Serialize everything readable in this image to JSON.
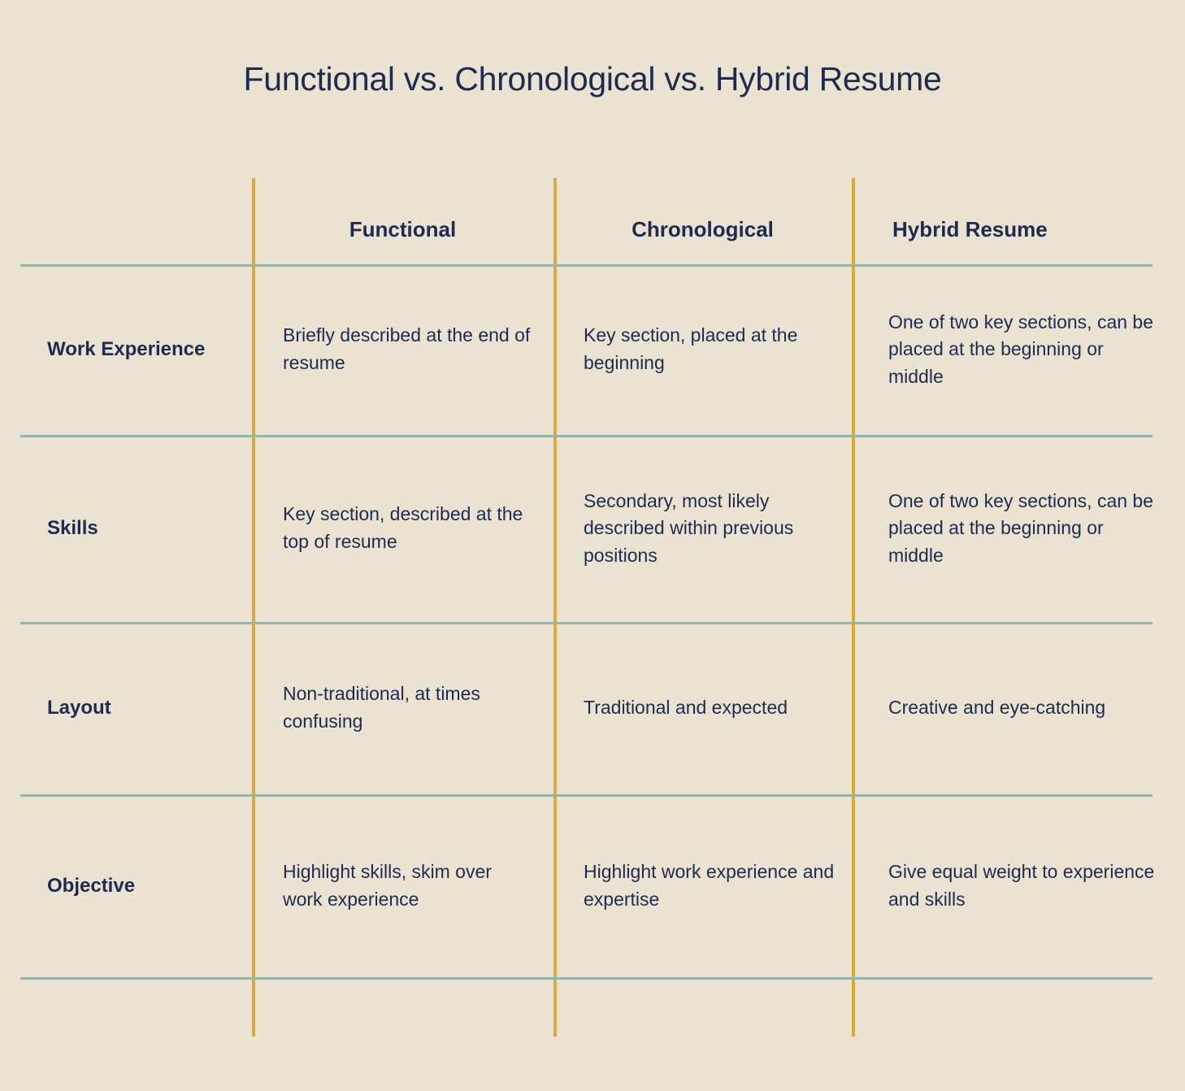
{
  "page": {
    "title": "Functional vs. Chronological vs. Hybrid Resume",
    "background_color": "#ebe3d2",
    "text_color": "#1f2a51",
    "vertical_rule_color": "#d9a93a",
    "horizontal_rule_color": "#8fb6ad"
  },
  "table": {
    "corner_label": "",
    "columns": [
      {
        "label": "Functional"
      },
      {
        "label": "Chronological"
      },
      {
        "label": "Hybrid Resume"
      }
    ],
    "rows": [
      {
        "label": "Work Experience",
        "cells": [
          "Briefly described at the end of resume",
          "Key section, placed at the beginning",
          "One of two key sections, can be placed at the beginning or middle"
        ]
      },
      {
        "label": "Skills",
        "cells": [
          "Key section, described at the top of resume",
          "Secondary, most likely described within previous positions",
          "One of two key sections, can be placed at the beginning or middle"
        ]
      },
      {
        "label": "Layout",
        "cells": [
          "Non-traditional, at times confusing",
          "Traditional and expected",
          "Creative and eye-catching"
        ]
      },
      {
        "label": "Objective",
        "cells": [
          "Highlight skills, skim over work experience",
          "Highlight work experience and expertise",
          "Give equal weight to experience and skills"
        ]
      }
    ]
  }
}
